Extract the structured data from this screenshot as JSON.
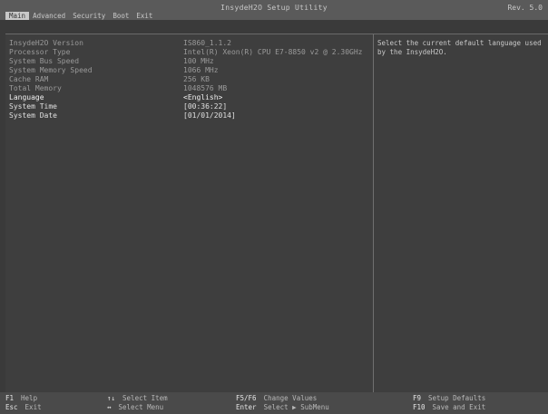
{
  "titlebar": {
    "title": "InsydeH2O Setup Utility",
    "revision": "Rev. 5.0",
    "tabs": [
      {
        "label": "Main",
        "active": true
      },
      {
        "label": "Advanced"
      },
      {
        "label": "Security"
      },
      {
        "label": "Boot"
      },
      {
        "label": "Exit"
      }
    ]
  },
  "main": {
    "rows": [
      {
        "label": "InsydeH2O Version",
        "value": "IS860_1.1.2"
      },
      {
        "label": "Processor Type",
        "value": "Intel(R) Xeon(R) CPU E7-8850 v2 @ 2.30GHz"
      },
      {
        "label": "System Bus Speed",
        "value": "100 MHz"
      },
      {
        "label": "System Memory Speed",
        "value": "1066 MHz"
      },
      {
        "label": "Cache RAM",
        "value": "256 KB"
      },
      {
        "label": "Total Memory",
        "value": "1048576 MB"
      },
      {
        "label": "Language",
        "value": "<English>"
      },
      {
        "label": "System Time",
        "value": "[00:36:22]"
      },
      {
        "label": "System Date",
        "value": "[01/01/2014]"
      }
    ]
  },
  "help": {
    "text": "Select the current default language used by the InsydeH2O."
  },
  "footer": {
    "keys": [
      {
        "key": "F1",
        "text": "Help"
      },
      {
        "key": "Esc",
        "text": "Exit"
      },
      {
        "key": "↑↓",
        "text": "Select Item"
      },
      {
        "key": "↔",
        "text": "Select Menu"
      },
      {
        "key": "F5/F6",
        "text": "Change Values"
      },
      {
        "key": "Enter",
        "text": "Select ▶ SubMenu"
      },
      {
        "key": "F9",
        "text": "Setup Defaults"
      },
      {
        "key": "F10",
        "text": "Save and Exit"
      }
    ]
  }
}
